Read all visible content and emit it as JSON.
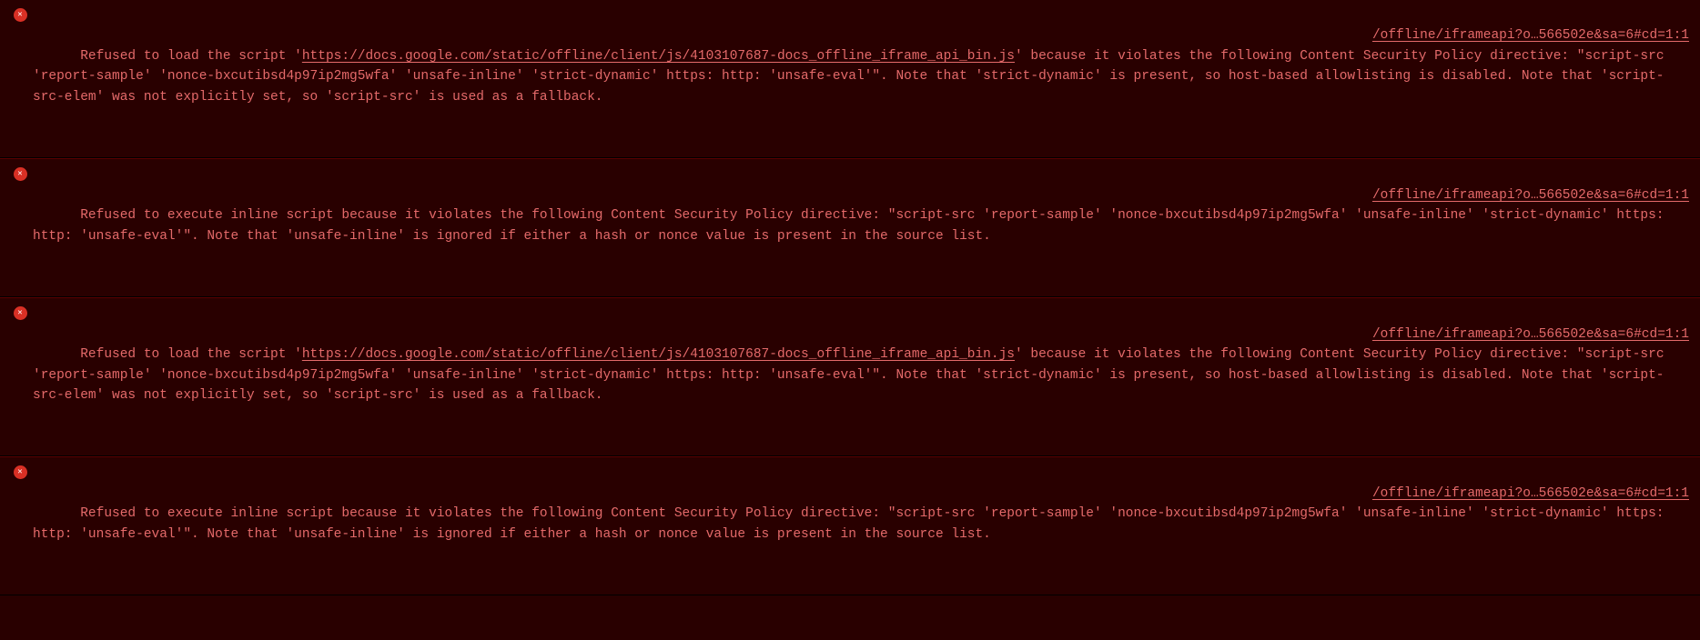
{
  "console": {
    "entries": [
      {
        "sourceLink": "/offline/iframeapi?o…566502e&sa=6#cd=1:1",
        "prefix": "Refused to load the script '",
        "url": "https://docs.google.com/static/offline/client/js/4103107687-docs_offline_iframe_api_bin.js",
        "suffix": "' because it violates the following Content Security Policy directive: \"script-src 'report-sample' 'nonce-bxcutibsd4p97ip2mg5wfa' 'unsafe-inline' 'strict-dynamic' https: http: 'unsafe-eval'\". Note that 'strict-dynamic' is present, so host-based allowlisting is disabled. Note that 'script-src-elem' was not explicitly set, so 'script-src' is used as a fallback.\n"
      },
      {
        "sourceLink": "/offline/iframeapi?o…566502e&sa=6#cd=1:1",
        "prefix": "Refused to execute inline script because it violates the following Content Security Policy directive: \"script-src 'report-sample' 'nonce-bxcutibsd4p97ip2mg5wfa' 'unsafe-inline' 'strict-dynamic' https: http: 'unsafe-eval'\". Note that 'unsafe-inline' is ignored if either a hash or nonce value is present in the source list.\n",
        "url": "",
        "suffix": ""
      },
      {
        "sourceLink": "/offline/iframeapi?o…566502e&sa=6#cd=1:1",
        "prefix": "Refused to load the script '",
        "url": "https://docs.google.com/static/offline/client/js/4103107687-docs_offline_iframe_api_bin.js",
        "suffix": "' because it violates the following Content Security Policy directive: \"script-src 'report-sample' 'nonce-bxcutibsd4p97ip2mg5wfa' 'unsafe-inline' 'strict-dynamic' https: http: 'unsafe-eval'\". Note that 'strict-dynamic' is present, so host-based allowlisting is disabled. Note that 'script-src-elem' was not explicitly set, so 'script-src' is used as a fallback.\n"
      },
      {
        "sourceLink": "/offline/iframeapi?o…566502e&sa=6#cd=1:1",
        "prefix": "Refused to execute inline script because it violates the following Content Security Policy directive: \"script-src 'report-sample' 'nonce-bxcutibsd4p97ip2mg5wfa' 'unsafe-inline' 'strict-dynamic' https: http: 'unsafe-eval'\". Note that 'unsafe-inline' is ignored if either a hash or nonce value is present in the source list.\n",
        "url": "",
        "suffix": ""
      }
    ]
  }
}
